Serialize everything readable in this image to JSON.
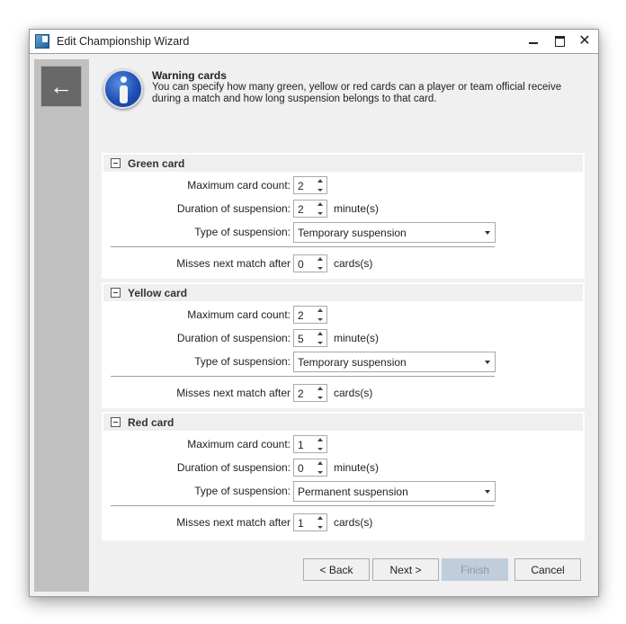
{
  "window": {
    "title": "Edit Championship Wizard",
    "controls": {
      "minimize": "–",
      "maximize": "□",
      "close": "✕"
    }
  },
  "sidebar": {
    "back_icon": "←"
  },
  "header": {
    "icon": "info-icon",
    "title": "Warning cards",
    "description": "You can specify how many green, yellow or red cards can a player or team official receive during a match and how long suspension belongs to that card."
  },
  "labels": {
    "max_count": "Maximum card count:",
    "duration": "Duration of suspension:",
    "type": "Type of suspension:",
    "misses": "Misses next match after",
    "minutes_unit": "minute(s)",
    "cards_unit": "cards(s)"
  },
  "groups": [
    {
      "title": "Green card",
      "max_count": "2",
      "duration": "2",
      "type": "Temporary suspension",
      "misses": "0"
    },
    {
      "title": "Yellow card",
      "max_count": "2",
      "duration": "5",
      "type": "Temporary suspension",
      "misses": "2"
    },
    {
      "title": "Red card",
      "max_count": "1",
      "duration": "0",
      "type": "Permanent suspension",
      "misses": "1"
    }
  ],
  "buttons": {
    "back": "< Back",
    "next": "Next >",
    "finish": "Finish",
    "finish_enabled": false,
    "cancel": "Cancel"
  }
}
